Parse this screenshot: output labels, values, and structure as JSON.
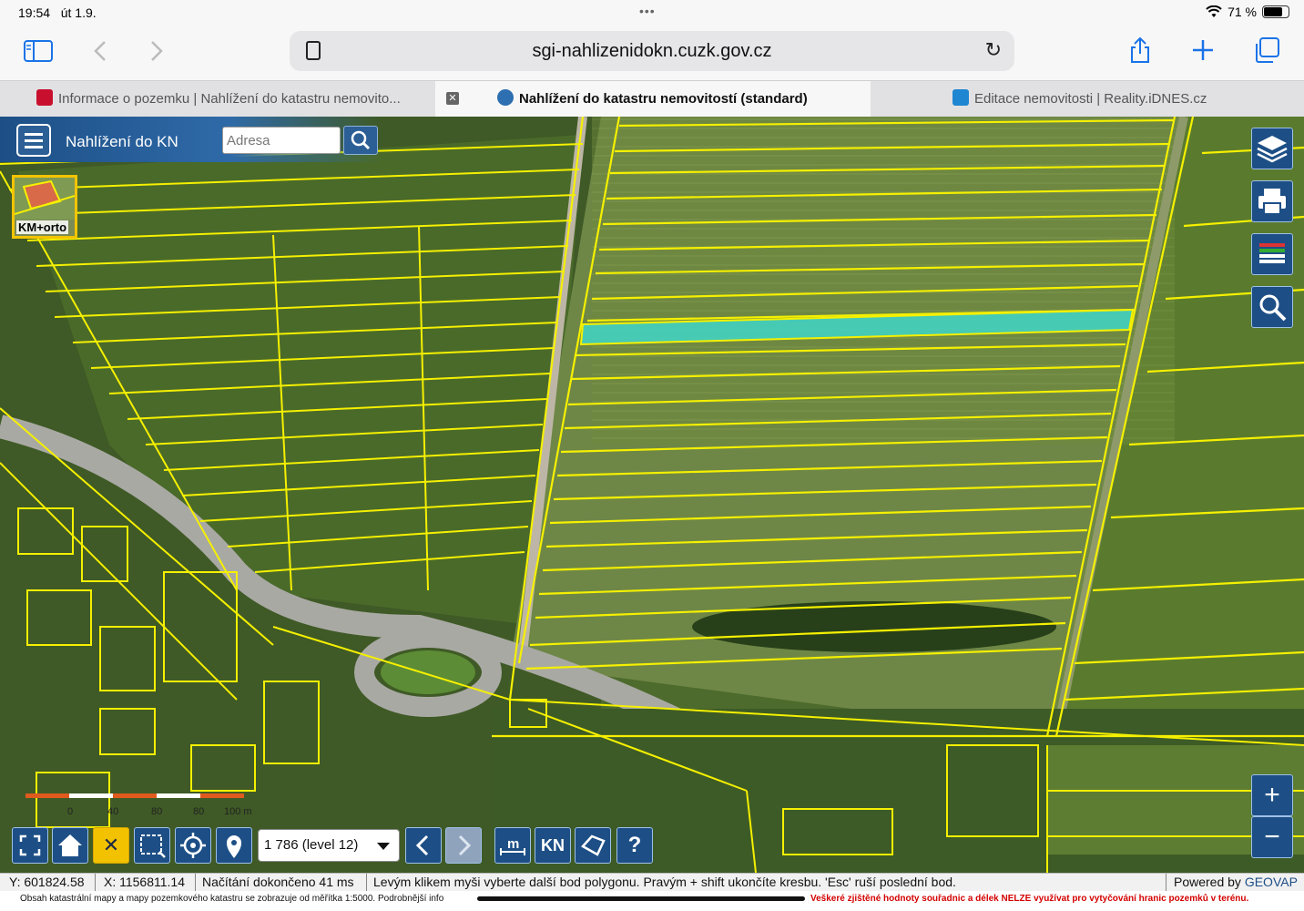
{
  "status_bar": {
    "time": "19:54",
    "date": "út 1.9.",
    "battery": "71 %",
    "battery_level": 0.71
  },
  "browser": {
    "url": "sgi-nahlizenidokn.cuzk.gov.cz",
    "tabs": [
      {
        "title": "Informace o pozemku | Nahlížení do katastru nemovito...",
        "active": false
      },
      {
        "title": "Nahlížení do katastru nemovitostí (standard)",
        "active": true
      },
      {
        "title": "Editace nemovitosti | Reality.iDNES.cz",
        "active": false
      }
    ]
  },
  "app": {
    "title": "Nahlížení do KN",
    "search_placeholder": "Adresa",
    "layer_thumb_label": "KM+orto",
    "scale_select": "1 786 (level 12)",
    "scale_labels": [
      "0",
      "40",
      "80",
      "80",
      "100 m"
    ],
    "kn_button": "KN",
    "help_button": "?",
    "zoom_in": "+",
    "zoom_out": "−"
  },
  "status": {
    "y": "Y: 601824.58",
    "x": "X: 1156811.14",
    "loading": "Načítání dokončeno 41 ms",
    "message": "Levým klikem myši vyberte další bod polygonu. Pravým + shift ukončíte kresbu. 'Esc' ruší poslední bod.",
    "powered_prefix": "Powered by ",
    "powered_brand": "GEOVAP"
  },
  "disclaimer": {
    "left": "Obsah katastrální mapy a mapy pozemkového katastru se zobrazuje od měřítka 1:5000. Podrobnější info",
    "right": "Veškeré zjištěné hodnoty souřadnic a délek NELZE využívat pro vytyčování hranic pozemků v terénu."
  },
  "colors": {
    "accent": "#1d4f86",
    "parcel_lines": "#f5f000",
    "selected_parcel": "#3fd6c8",
    "warning_text": "#d40000"
  }
}
